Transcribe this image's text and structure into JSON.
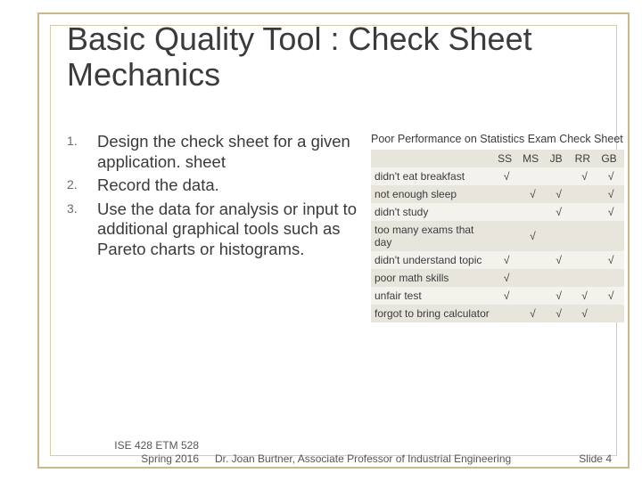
{
  "title": "Basic Quality Tool : Check Sheet Mechanics",
  "list": {
    "items": [
      "Design the check sheet for a given application. sheet",
      "Record the data.",
      "Use the data for analysis or input to additional graphical tools such as Pareto charts or histograms."
    ]
  },
  "sheet": {
    "caption": "Poor Performance on Statistics Exam Check Sheet",
    "cols": [
      "SS",
      "MS",
      "JB",
      "RR",
      "GB"
    ],
    "rows": [
      {
        "label": "didn't eat breakfast",
        "marks": [
          "√",
          "",
          "",
          "√",
          "√"
        ]
      },
      {
        "label": "not enough sleep",
        "marks": [
          "",
          "√",
          "√",
          "",
          "√"
        ]
      },
      {
        "label": "didn't study",
        "marks": [
          "",
          "",
          "√",
          "",
          "√"
        ]
      },
      {
        "label": "too many exams that day",
        "marks": [
          "",
          "√",
          "",
          "",
          ""
        ]
      },
      {
        "label": "didn't understand topic",
        "marks": [
          "√",
          "",
          "√",
          "",
          "√"
        ]
      },
      {
        "label": "poor math skills",
        "marks": [
          "√",
          "",
          "",
          "",
          ""
        ]
      },
      {
        "label": "unfair test",
        "marks": [
          "√",
          "",
          "√",
          "√",
          "√"
        ]
      },
      {
        "label": "forgot to bring calculator",
        "marks": [
          "",
          "√",
          "√",
          "√",
          ""
        ]
      }
    ]
  },
  "footer": {
    "left": "ISE 428 ETM 528 Spring 2016",
    "mid": "Dr. Joan Burtner, Associate Professor of Industrial Engineering",
    "right": "Slide 4"
  }
}
